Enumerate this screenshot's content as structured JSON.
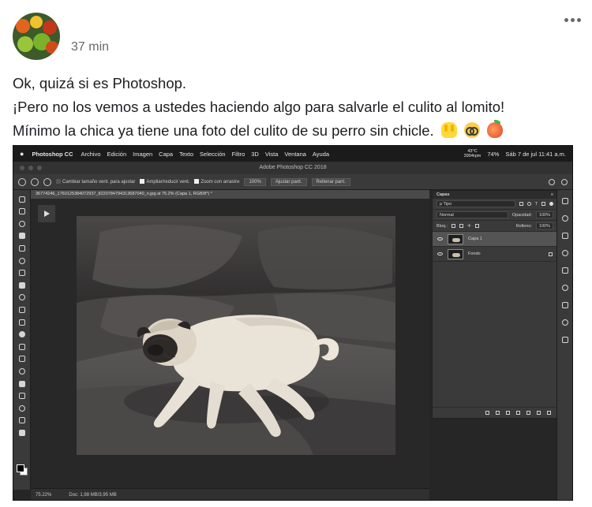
{
  "post": {
    "timestamp": "37 min",
    "lines": [
      "Ok, quizá si es Photoshop.",
      "¡Pero no los vemos a ustedes haciendo algo para salvarle el culito al lomito!",
      "Mínimo la chica ya tiene una foto del culito de su perro sin chicle."
    ],
    "emojis": [
      "raising-hands-emoji",
      "nerd-face-emoji",
      "peach-emoji"
    ]
  },
  "screenshot": {
    "menubar": {
      "app": "Photoshop CC",
      "menus": [
        "Archivo",
        "Edición",
        "Imagen",
        "Capa",
        "Texto",
        "Selección",
        "Filtro",
        "3D",
        "Vista",
        "Ventana",
        "Ayuda"
      ],
      "temp": "43°C",
      "rpm": "3994rpm",
      "battery": "74%",
      "clock": "Sáb 7 de jul  11:41 a.m."
    },
    "window_title": "Adobe Photoshop CC 2018",
    "options": {
      "resize_label": "Cambiar tamaño vent. para ajustar",
      "zoom_all_label": "Ampliar/reducir vent.",
      "scrubby_label": "Zoom con arrastre",
      "zoom_value": "100%",
      "fit_button": "Ajustar pant.",
      "fill_button": "Rellenar pant."
    },
    "document_tab": "36774246_1760125384072937_8220784794313687040_n.jpg al 75.2% (Capa 1, RGB/8*) *",
    "status": {
      "zoom": "75.22%",
      "doc_size": "Doc: 1,98 MB/3,95 MB"
    },
    "layers_panel": {
      "title": "Capas",
      "filter_label": "ρ Tipo",
      "blend_mode": "Normal",
      "opacity_label": "Opacidad:",
      "opacity_value": "100%",
      "lock_label": "Bloq.:",
      "fill_label": "Relleno:",
      "fill_value": "100%",
      "layers": [
        {
          "name": "Capa 1",
          "selected": true
        },
        {
          "name": "Fondo",
          "selected": false
        }
      ]
    }
  },
  "colors": {
    "ps_bg": "#262626",
    "text_primary": "#1c1e21",
    "text_secondary": "#65676b"
  }
}
